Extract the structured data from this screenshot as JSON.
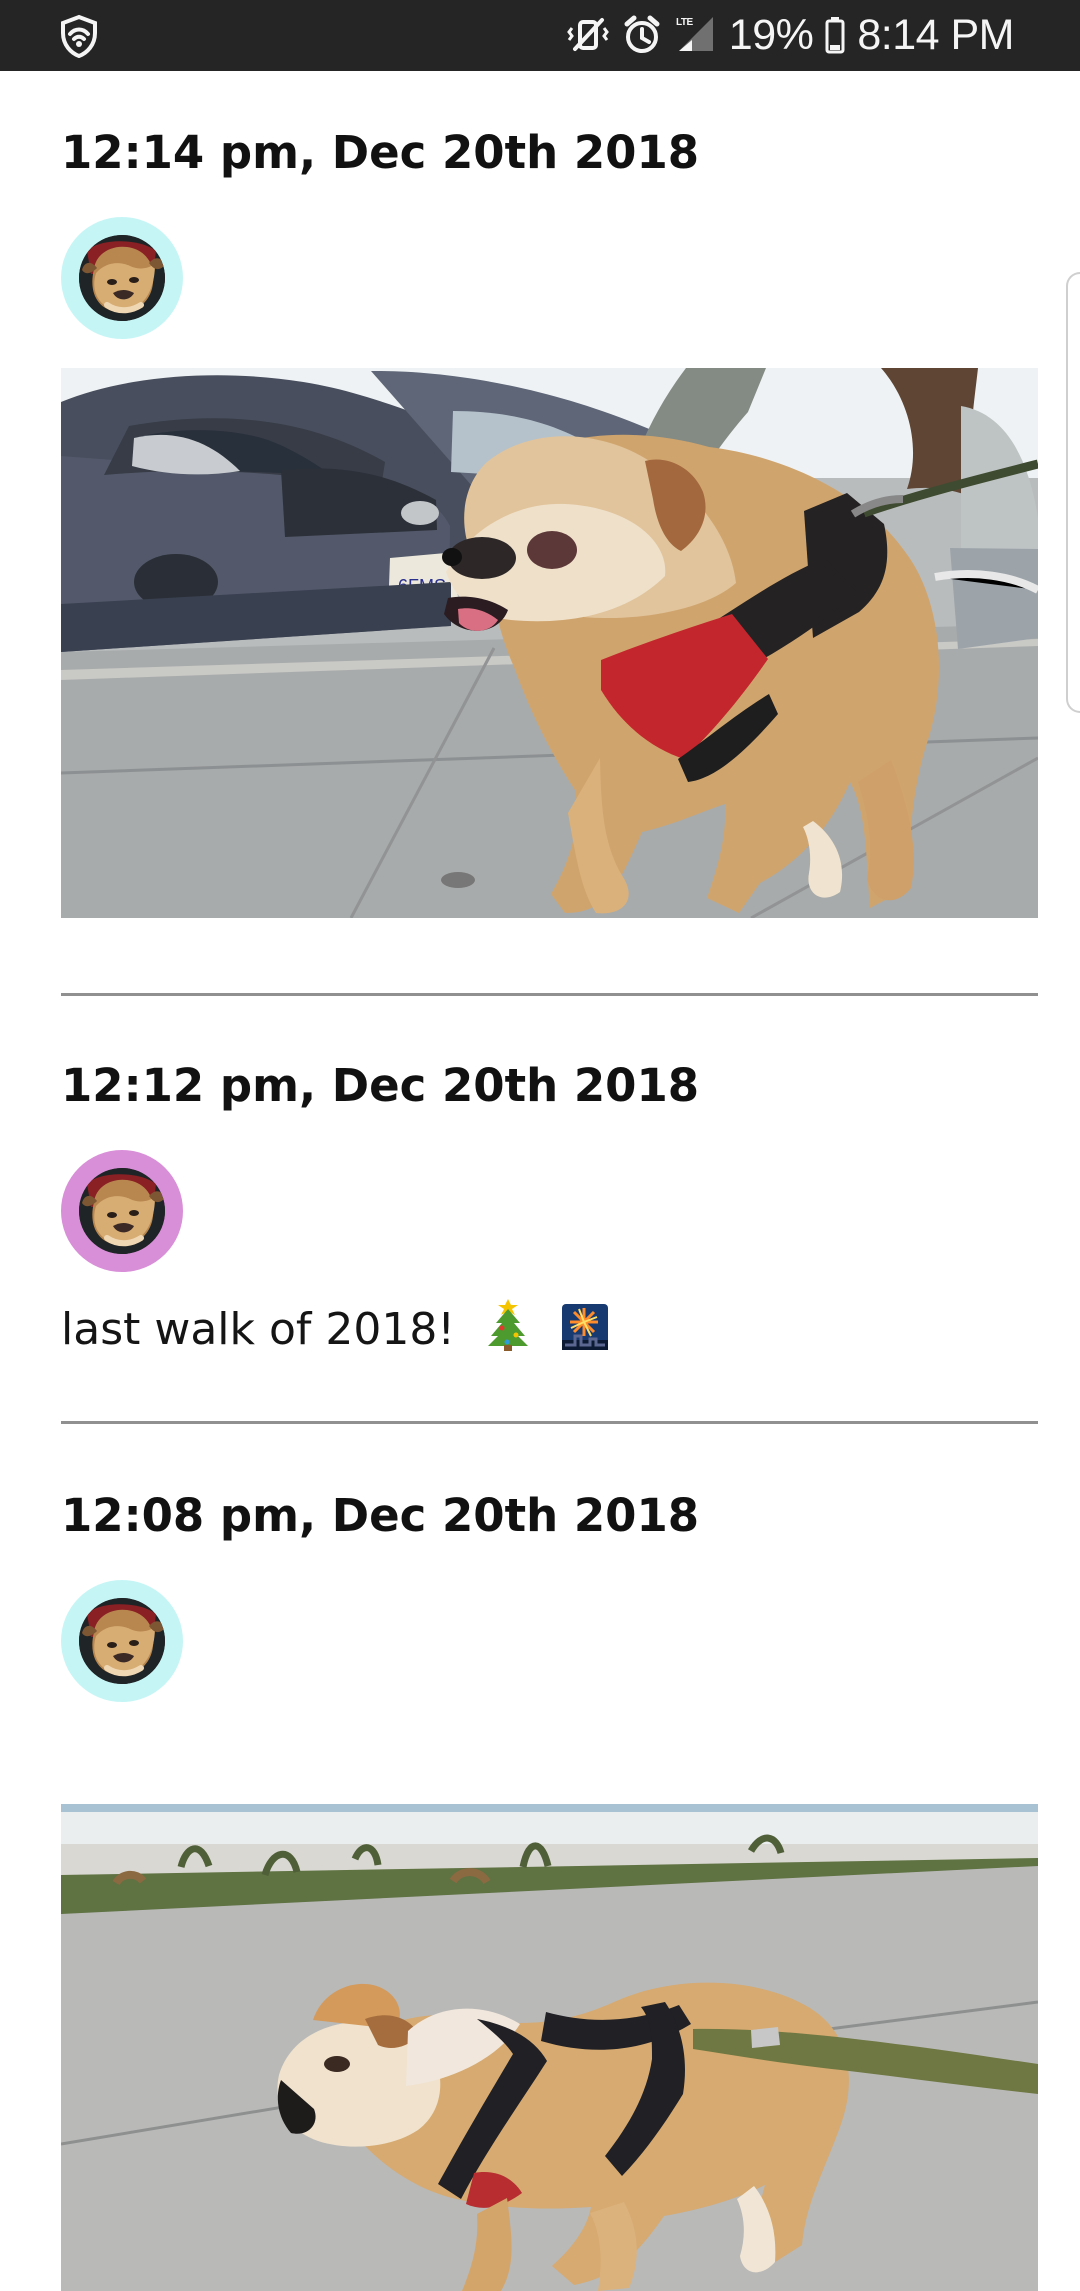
{
  "status_bar": {
    "battery_percent": "19%",
    "time": "8:14 PM",
    "network_type": "LTE",
    "icons": [
      "shield-icon",
      "vibrate-mute-icon",
      "alarm-icon",
      "lte-signal-icon",
      "battery-icon"
    ]
  },
  "posts": [
    {
      "date": "12:14 pm, Dec 20th 2018",
      "avatar_ring_color": "#c6f5f6",
      "photo_subject": "bulldog-walking-past-parked-cars"
    },
    {
      "date": "12:12 pm, Dec 20th 2018",
      "avatar_ring_color": "#d98ed8",
      "text": "last walk of 2018!",
      "emojis": [
        "christmas-tree-emoji",
        "fireworks-emoji"
      ]
    },
    {
      "date": "12:08 pm, Dec 20th 2018",
      "avatar_ring_color": "#c6f5f6",
      "photo_subject": "bulldog-on-sidewalk-with-green-leash"
    }
  ]
}
